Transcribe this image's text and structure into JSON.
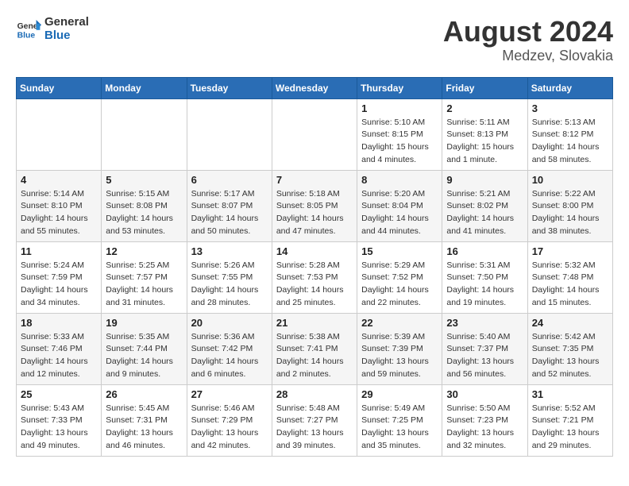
{
  "header": {
    "logo_general": "General",
    "logo_blue": "Blue",
    "month_year": "August 2024",
    "location": "Medzev, Slovakia"
  },
  "weekdays": [
    "Sunday",
    "Monday",
    "Tuesday",
    "Wednesday",
    "Thursday",
    "Friday",
    "Saturday"
  ],
  "weeks": [
    [
      {
        "day": "",
        "info": ""
      },
      {
        "day": "",
        "info": ""
      },
      {
        "day": "",
        "info": ""
      },
      {
        "day": "",
        "info": ""
      },
      {
        "day": "1",
        "info": "Sunrise: 5:10 AM\nSunset: 8:15 PM\nDaylight: 15 hours\nand 4 minutes."
      },
      {
        "day": "2",
        "info": "Sunrise: 5:11 AM\nSunset: 8:13 PM\nDaylight: 15 hours\nand 1 minute."
      },
      {
        "day": "3",
        "info": "Sunrise: 5:13 AM\nSunset: 8:12 PM\nDaylight: 14 hours\nand 58 minutes."
      }
    ],
    [
      {
        "day": "4",
        "info": "Sunrise: 5:14 AM\nSunset: 8:10 PM\nDaylight: 14 hours\nand 55 minutes."
      },
      {
        "day": "5",
        "info": "Sunrise: 5:15 AM\nSunset: 8:08 PM\nDaylight: 14 hours\nand 53 minutes."
      },
      {
        "day": "6",
        "info": "Sunrise: 5:17 AM\nSunset: 8:07 PM\nDaylight: 14 hours\nand 50 minutes."
      },
      {
        "day": "7",
        "info": "Sunrise: 5:18 AM\nSunset: 8:05 PM\nDaylight: 14 hours\nand 47 minutes."
      },
      {
        "day": "8",
        "info": "Sunrise: 5:20 AM\nSunset: 8:04 PM\nDaylight: 14 hours\nand 44 minutes."
      },
      {
        "day": "9",
        "info": "Sunrise: 5:21 AM\nSunset: 8:02 PM\nDaylight: 14 hours\nand 41 minutes."
      },
      {
        "day": "10",
        "info": "Sunrise: 5:22 AM\nSunset: 8:00 PM\nDaylight: 14 hours\nand 38 minutes."
      }
    ],
    [
      {
        "day": "11",
        "info": "Sunrise: 5:24 AM\nSunset: 7:59 PM\nDaylight: 14 hours\nand 34 minutes."
      },
      {
        "day": "12",
        "info": "Sunrise: 5:25 AM\nSunset: 7:57 PM\nDaylight: 14 hours\nand 31 minutes."
      },
      {
        "day": "13",
        "info": "Sunrise: 5:26 AM\nSunset: 7:55 PM\nDaylight: 14 hours\nand 28 minutes."
      },
      {
        "day": "14",
        "info": "Sunrise: 5:28 AM\nSunset: 7:53 PM\nDaylight: 14 hours\nand 25 minutes."
      },
      {
        "day": "15",
        "info": "Sunrise: 5:29 AM\nSunset: 7:52 PM\nDaylight: 14 hours\nand 22 minutes."
      },
      {
        "day": "16",
        "info": "Sunrise: 5:31 AM\nSunset: 7:50 PM\nDaylight: 14 hours\nand 19 minutes."
      },
      {
        "day": "17",
        "info": "Sunrise: 5:32 AM\nSunset: 7:48 PM\nDaylight: 14 hours\nand 15 minutes."
      }
    ],
    [
      {
        "day": "18",
        "info": "Sunrise: 5:33 AM\nSunset: 7:46 PM\nDaylight: 14 hours\nand 12 minutes."
      },
      {
        "day": "19",
        "info": "Sunrise: 5:35 AM\nSunset: 7:44 PM\nDaylight: 14 hours\nand 9 minutes."
      },
      {
        "day": "20",
        "info": "Sunrise: 5:36 AM\nSunset: 7:42 PM\nDaylight: 14 hours\nand 6 minutes."
      },
      {
        "day": "21",
        "info": "Sunrise: 5:38 AM\nSunset: 7:41 PM\nDaylight: 14 hours\nand 2 minutes."
      },
      {
        "day": "22",
        "info": "Sunrise: 5:39 AM\nSunset: 7:39 PM\nDaylight: 13 hours\nand 59 minutes."
      },
      {
        "day": "23",
        "info": "Sunrise: 5:40 AM\nSunset: 7:37 PM\nDaylight: 13 hours\nand 56 minutes."
      },
      {
        "day": "24",
        "info": "Sunrise: 5:42 AM\nSunset: 7:35 PM\nDaylight: 13 hours\nand 52 minutes."
      }
    ],
    [
      {
        "day": "25",
        "info": "Sunrise: 5:43 AM\nSunset: 7:33 PM\nDaylight: 13 hours\nand 49 minutes."
      },
      {
        "day": "26",
        "info": "Sunrise: 5:45 AM\nSunset: 7:31 PM\nDaylight: 13 hours\nand 46 minutes."
      },
      {
        "day": "27",
        "info": "Sunrise: 5:46 AM\nSunset: 7:29 PM\nDaylight: 13 hours\nand 42 minutes."
      },
      {
        "day": "28",
        "info": "Sunrise: 5:48 AM\nSunset: 7:27 PM\nDaylight: 13 hours\nand 39 minutes."
      },
      {
        "day": "29",
        "info": "Sunrise: 5:49 AM\nSunset: 7:25 PM\nDaylight: 13 hours\nand 35 minutes."
      },
      {
        "day": "30",
        "info": "Sunrise: 5:50 AM\nSunset: 7:23 PM\nDaylight: 13 hours\nand 32 minutes."
      },
      {
        "day": "31",
        "info": "Sunrise: 5:52 AM\nSunset: 7:21 PM\nDaylight: 13 hours\nand 29 minutes."
      }
    ]
  ]
}
